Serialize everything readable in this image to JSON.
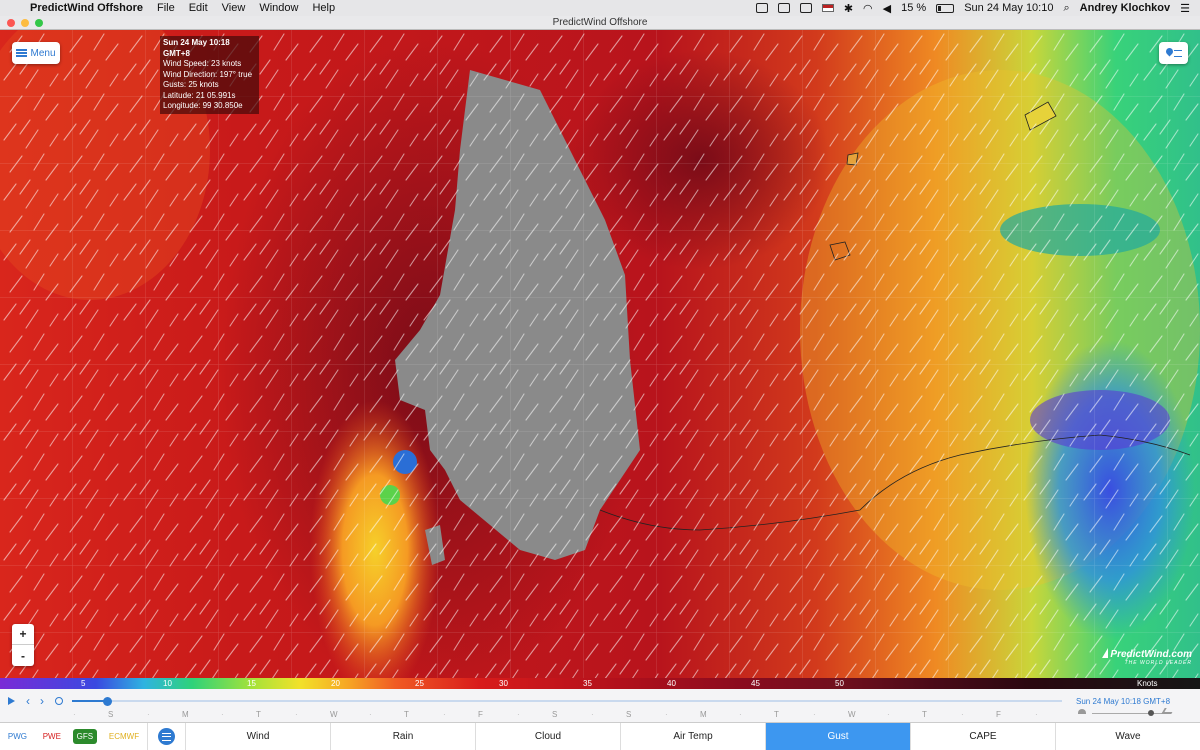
{
  "menubar": {
    "app_name": "PredictWind Offshore",
    "menus": [
      "File",
      "Edit",
      "View",
      "Help",
      "Window"
    ],
    "battery": "15 %",
    "datetime": "Sun 24 May  10:10",
    "user": "Andrey Klochkov"
  },
  "window": {
    "title": "PredictWind Offshore"
  },
  "map": {
    "menu_label": "Menu",
    "info": {
      "title": "Sun 24 May 10:18 GMT+8",
      "wind_speed": "Wind Speed: 23 knots",
      "wind_direction": "Wind Direction: 197° true",
      "gusts": "Gusts: 25 knots",
      "latitude": "Latitude: 21 05.991s",
      "longitude": "Longitude: 99 30.850e"
    },
    "zoom_in": "+",
    "zoom_out": "-",
    "logo": {
      "name": "PredictWind.com",
      "tagline": "THE WORLD LEADER"
    }
  },
  "legend": {
    "ticks": [
      "5",
      "10",
      "15",
      "20",
      "25",
      "30",
      "35",
      "40",
      "45",
      "50"
    ],
    "unit": "Knots"
  },
  "timeline": {
    "days": [
      "S",
      "M",
      "T",
      "W",
      "T",
      "F",
      "S",
      "S",
      "M",
      "T",
      "W",
      "T",
      "F"
    ],
    "current_time": "Sun 24 May 10:18 GMT+8",
    "position_fraction": 0.035
  },
  "models": {
    "items": [
      "PWG",
      "PWE",
      "GFS",
      "ECMWF"
    ],
    "active": "GFS",
    "colors": {
      "PWG": "#2e7ad1",
      "PWE": "#d62020",
      "GFS": "#ffffff",
      "ECMWF": "#e0b020"
    }
  },
  "tabs": {
    "items": [
      "Wind",
      "Rain",
      "Cloud",
      "Air Temp",
      "Gust",
      "CAPE",
      "Wave"
    ],
    "active": "Gust",
    "active_color": "#3d97f0"
  }
}
